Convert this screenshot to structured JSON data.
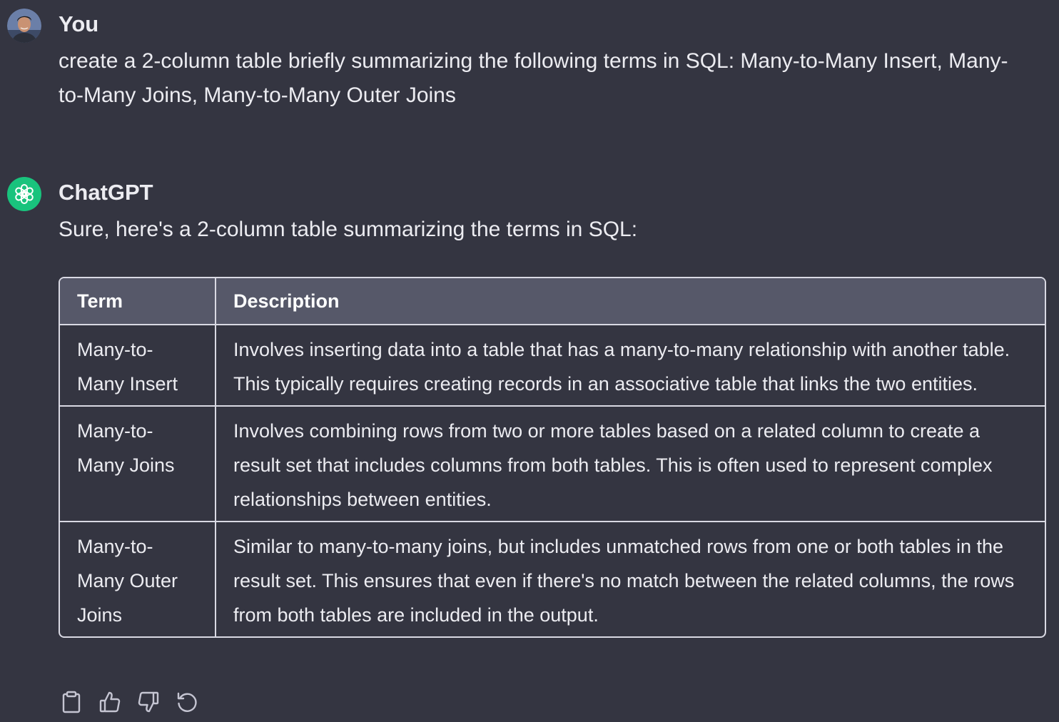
{
  "user_message": {
    "author": "You",
    "text": "create a 2-column table briefly summarizing the following terms in SQL: Many-to-Many Insert, Many-to-Many Joins, Many-to-Many Outer Joins"
  },
  "assistant_message": {
    "author": "ChatGPT",
    "intro": "Sure, here's a 2-column table summarizing the terms in SQL:",
    "table": {
      "headers": [
        "Term",
        "Description"
      ],
      "rows": [
        {
          "term": "Many-to-Many Insert",
          "description": "Involves inserting data into a table that has a many-to-many relationship with another table. This typically requires creating records in an associative table that links the two entities."
        },
        {
          "term": "Many-to-Many Joins",
          "description": "Involves combining rows from two or more tables based on a related column to create a result set that includes columns from both tables. This is often used to represent complex relationships between entities."
        },
        {
          "term": "Many-to-Many Outer Joins",
          "description": "Similar to many-to-many joins, but includes unmatched rows from one or both tables in the result set. This ensures that even if there's no match between the related columns, the rows from both tables are included in the output."
        }
      ]
    }
  },
  "actions": [
    {
      "icon": "clipboard-icon"
    },
    {
      "icon": "thumbs-up-icon"
    },
    {
      "icon": "thumbs-down-icon"
    },
    {
      "icon": "regenerate-icon"
    }
  ],
  "colors": {
    "background": "#343541",
    "header_row": "#565869",
    "assistant_avatar": "#19c37d",
    "text": "#ececf1"
  }
}
